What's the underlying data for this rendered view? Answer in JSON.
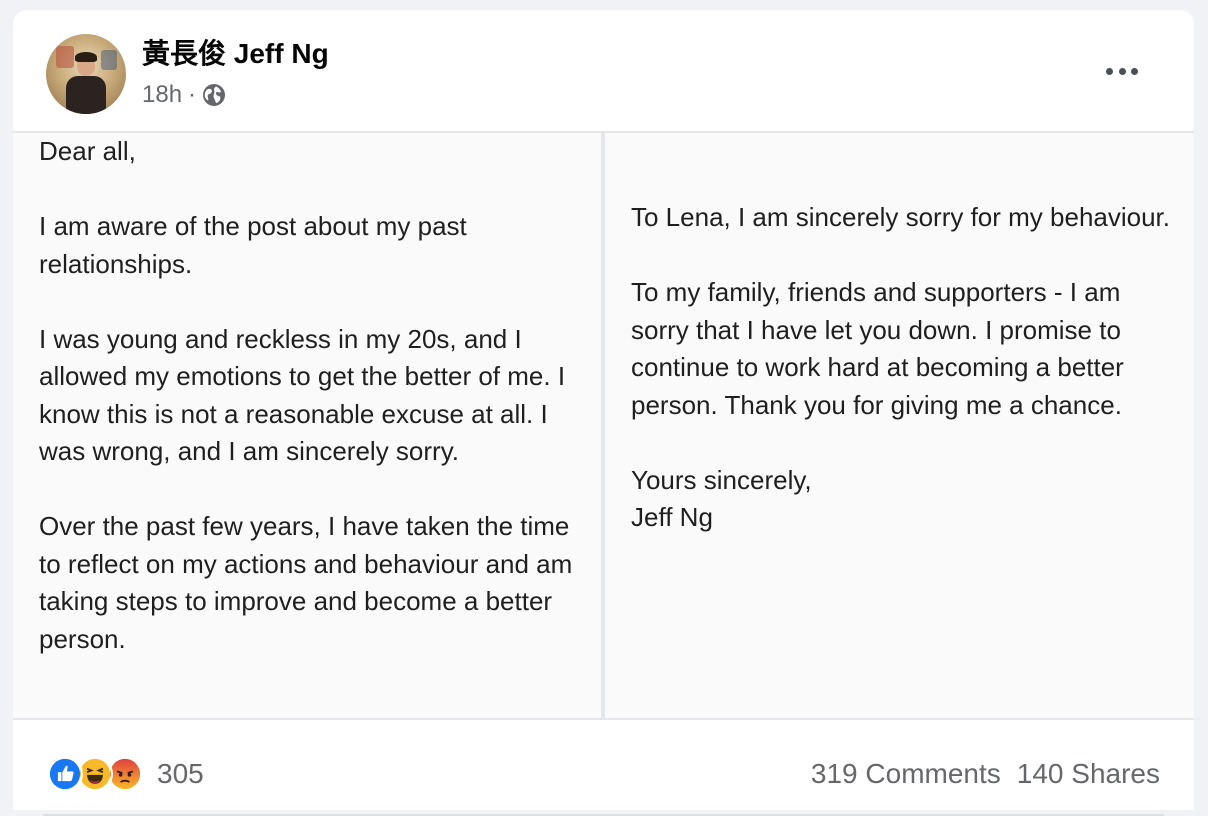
{
  "post": {
    "author": "黃長俊 Jeff Ng",
    "time": "18h",
    "separator": "·",
    "privacy_icon": "globe-icon",
    "more_icon": "more-options-icon"
  },
  "photo": {
    "left_text": "Dear all,\n\nI am aware of the post about my past relationships.\n\nI was young and reckless in my 20s, and I allowed my emotions to get the better of me. I know this is not a reasonable excuse at all. I was wrong, and I am sincerely sorry.\n\nOver the past few years, I have taken the time to reflect on my actions and behaviour and am taking steps to improve and become a better person.",
    "right_text": "To Lena, I am sincerely sorry for my behaviour.\n\nTo my family, friends and supporters - I am sorry that I have let you down. I promise to continue to work hard at becoming a better person. Thank you for giving me a chance.\n\nYours sincerely,\nJeff Ng"
  },
  "engagement": {
    "reaction_icons": [
      "like-icon",
      "haha-icon",
      "angry-icon"
    ],
    "reaction_count": "305",
    "comments": "319 Comments",
    "shares": "140 Shares"
  },
  "colors": {
    "like": "#1877f2",
    "haha": "#f7b928",
    "angry": "#e9710f",
    "secondary_text": "#65676b"
  }
}
